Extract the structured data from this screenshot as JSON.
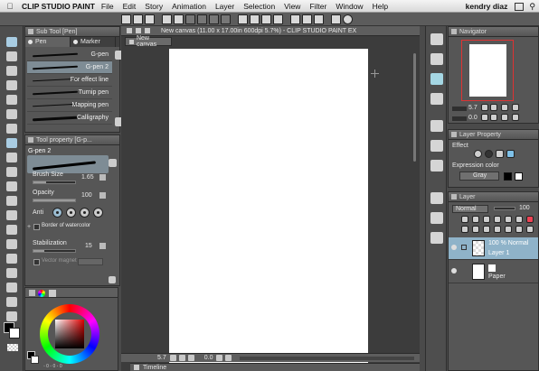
{
  "menubar": {
    "app_name": "CLIP STUDIO PAINT",
    "items": [
      "File",
      "Edit",
      "Story",
      "Animation",
      "Layer",
      "Selection",
      "View",
      "Filter",
      "Window",
      "Help"
    ],
    "user": "kendry diaz"
  },
  "subtool": {
    "title": "Sub Tool [Pen]",
    "tabs": [
      "Pen",
      "Marker"
    ],
    "brushes": [
      "G-pen",
      "G-pen 2",
      "For effect line",
      "Turnip pen",
      "Mapping pen",
      "Calligraphy"
    ],
    "selected_index": 1
  },
  "toolprop": {
    "title": "Tool property [G-p...",
    "brush_name": "G-pen 2",
    "brush_size_label": "Brush Size",
    "brush_size_value": "1.65",
    "opacity_label": "Opacity",
    "opacity_value": "100",
    "antialias_label": "Anti",
    "border_label": "Border of watercolor",
    "stabilization_label": "Stabilization",
    "stabilization_value": "15",
    "vector_magnet_label": "Vector magnet"
  },
  "canvas": {
    "doc_title": "New canvas (11.00 x 17.00in 600dpi 5.7%) - CLIP STUDIO PAINT EX",
    "tab_label": "New canvas",
    "zoom": "5.7",
    "angle": "0.0",
    "timeline_label": "Timeline"
  },
  "navigator": {
    "title": "Navigator",
    "zoom": "5.7",
    "angle": "0.0"
  },
  "layerprop": {
    "title": "Layer Property",
    "effect_label": "Effect",
    "expression_color_label": "Expression color",
    "expression_color_value": "Gray"
  },
  "layers": {
    "title": "Layer",
    "blend_mode": "Normal",
    "opacity": "100",
    "items": [
      {
        "name": "Layer 1",
        "info": "100 % Normal"
      },
      {
        "name": "Paper",
        "info": ""
      }
    ]
  },
  "colors": {
    "accent_selected": "#8fb3c9",
    "brush_selected": "#7e8c95",
    "navigator_frame": "#dd3333"
  }
}
